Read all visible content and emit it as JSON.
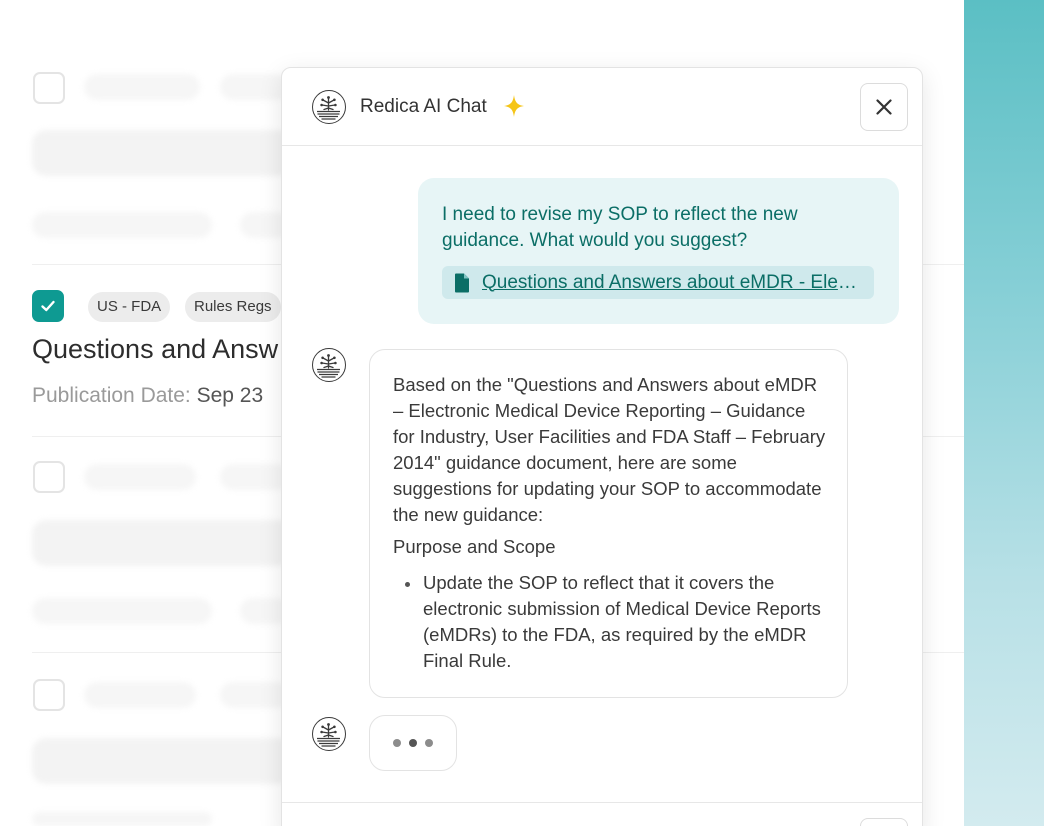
{
  "colors": {
    "accent": "#0e9a92",
    "user_bubble_bg": "#e7f5f6",
    "user_text": "#0b6e66",
    "sparkle": "#f5c518"
  },
  "list": {
    "tags": [
      "US - FDA",
      "Rules Regs"
    ],
    "document_title": "Questions and Answ",
    "publication_label": "Publication Date:",
    "publication_value": "Sep 23"
  },
  "chat": {
    "title": "Redica AI Chat",
    "icons": {
      "logo": "redica-tree-logo-icon",
      "sparkle": "sparkle-icon",
      "close": "close-icon",
      "document": "document-icon"
    },
    "user_message": {
      "text": "I need to revise my SOP to reflect the new guidance. What would you suggest?",
      "attachment": "Questions and Answers about eMDR - Electronic Medical Device Reporting"
    },
    "ai_message": {
      "paragraph": "Based on the \"Questions and Answers about eMDR – Electronic Medical Device Reporting – Guidance for Industry, User Facilities and FDA Staff – February 2014\" guidance document, here are some suggestions for updating your SOP to accommodate the new guidance:",
      "subheading": "Purpose and Scope",
      "bullets": [
        "Update the SOP to reflect that it covers the electronic submission of Medical Device Reports (eMDRs) to the FDA, as required by the eMDR Final Rule."
      ]
    }
  }
}
